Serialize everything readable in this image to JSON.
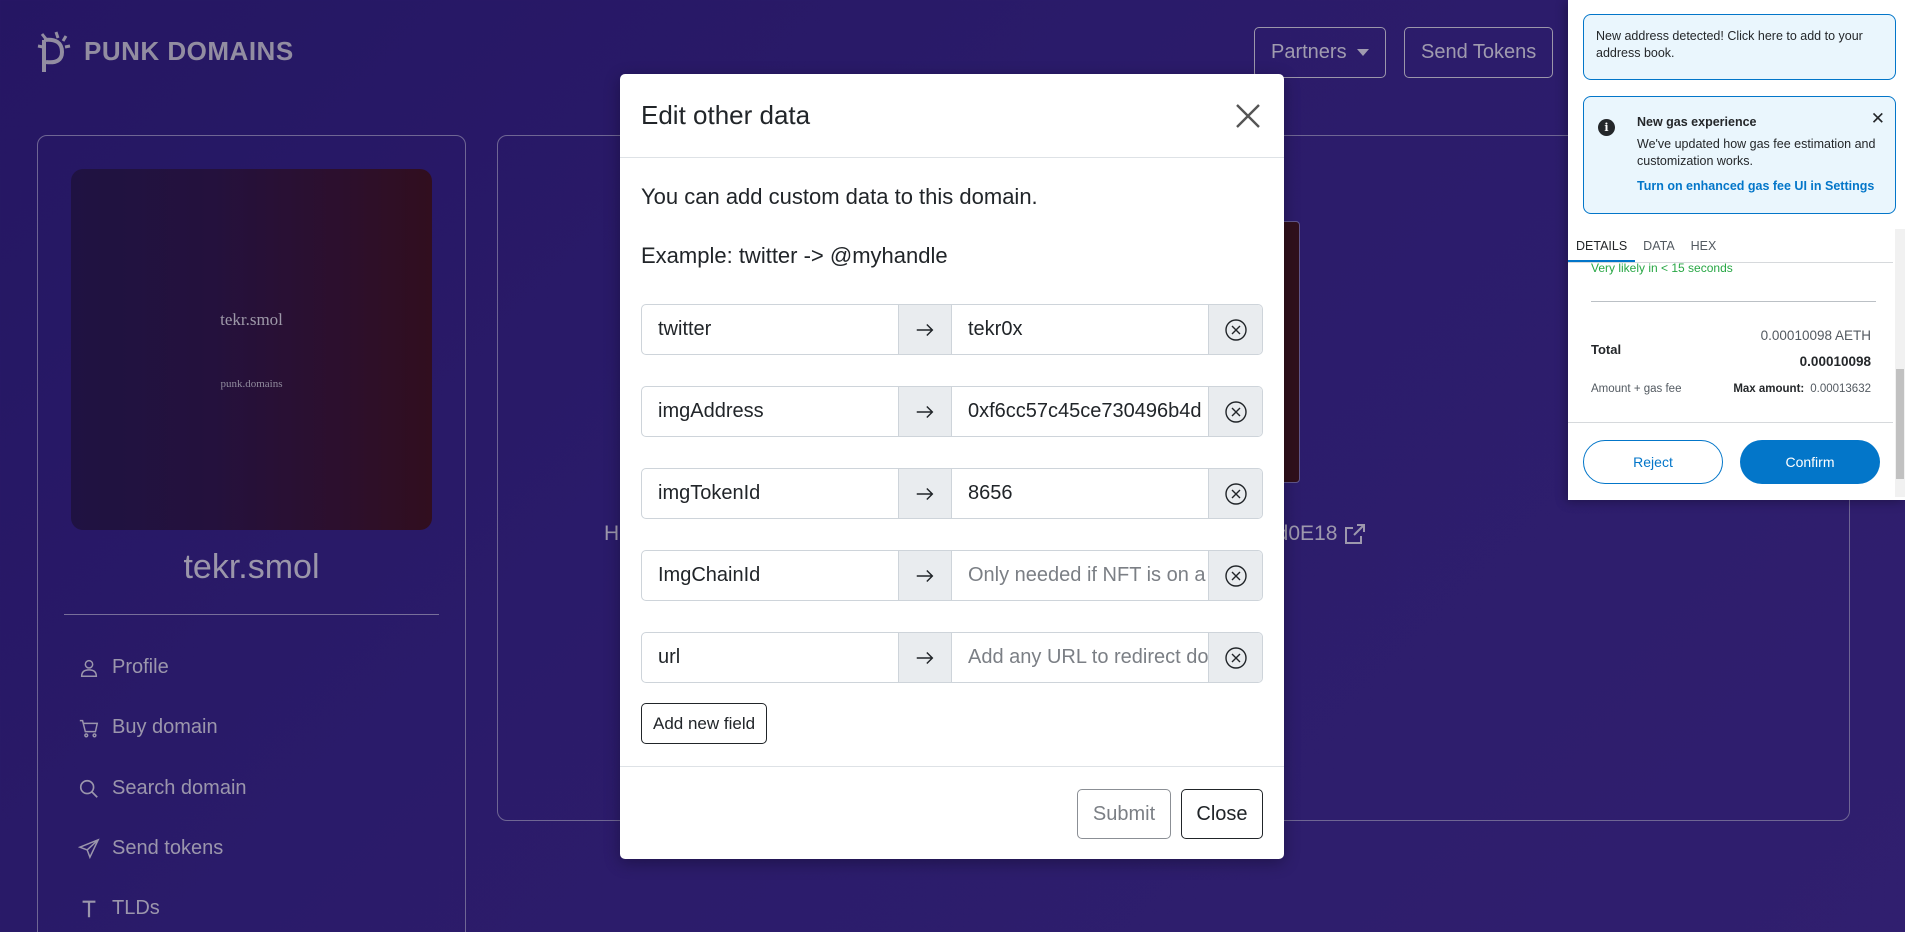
{
  "site": {
    "logo_text": "PUNK DOMAINS",
    "nav": {
      "partners_label": "Partners",
      "send_tokens_label": "Send Tokens"
    }
  },
  "profile": {
    "nft_name": "tekr.smol",
    "nft_sub": "punk.domains",
    "domain_title": "tekr.smol",
    "menu": [
      {
        "label": "Profile",
        "icon": "user-icon"
      },
      {
        "label": "Buy domain",
        "icon": "cart-icon"
      },
      {
        "label": "Search domain",
        "icon": "search-icon"
      },
      {
        "label": "Send tokens",
        "icon": "send-icon"
      },
      {
        "label": "TLDs",
        "icon": "tld-icon"
      }
    ]
  },
  "main": {
    "holder_prefix": "H",
    "address_suffix": "6d0E18"
  },
  "modal": {
    "title": "Edit other data",
    "intro": "You can add custom data to this domain.",
    "example": "Example: twitter -> @myhandle",
    "fields": [
      {
        "key": "twitter",
        "value": "tekr0x",
        "placeholder": ""
      },
      {
        "key": "imgAddress",
        "value": "0xf6cc57c45ce730496b4d",
        "placeholder": ""
      },
      {
        "key": "imgTokenId",
        "value": "8656",
        "placeholder": ""
      },
      {
        "key": "ImgChainId",
        "value": "",
        "placeholder": "Only needed if NFT is on a"
      },
      {
        "key": "url",
        "value": "",
        "placeholder": "Add any URL to redirect do"
      }
    ],
    "add_field_label": "Add new field",
    "submit_label": "Submit",
    "close_label": "Close"
  },
  "wallet": {
    "notice_address": "New address detected! Click here to add to your address book.",
    "gas_title": "New gas experience",
    "gas_body": "We've updated how gas fee estimation and customization works.",
    "gas_link": "Turn on enhanced gas fee UI in Settings",
    "tabs": [
      "DETAILS",
      "DATA",
      "HEX"
    ],
    "active_tab": "DETAILS",
    "likely": "Very likely in < 15 seconds",
    "total_value": "0.00010098 AETH",
    "total_label": "Total",
    "total_bold": "0.00010098",
    "amount_gas_label": "Amount + gas fee",
    "max_amount_label": "Max amount:",
    "max_amount_value": "0.00013632",
    "reject_label": "Reject",
    "confirm_label": "Confirm",
    "colors": {
      "primary": "#0376c9",
      "success": "#28a745"
    }
  }
}
